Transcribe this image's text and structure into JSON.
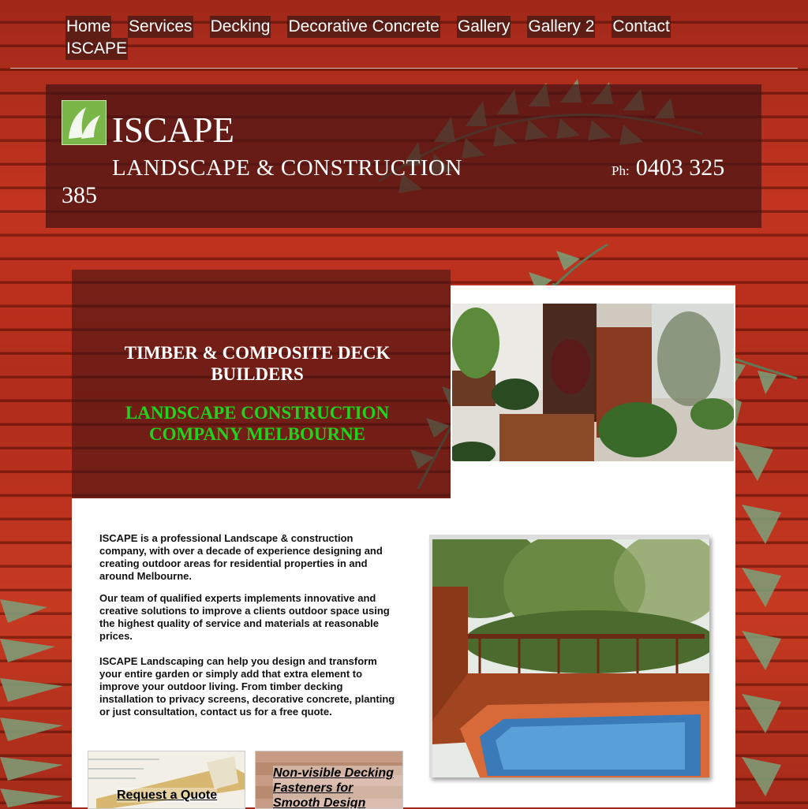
{
  "nav": {
    "items": [
      "Home",
      "Services",
      "Decking",
      "Decorative Concrete",
      "Gallery",
      "Gallery 2",
      "Contact",
      "ISCAPE"
    ]
  },
  "header": {
    "brand": "ISCAPE",
    "tagline": "LANDSCAPE & CONSTRUCTION",
    "phone_prefix": "Ph:",
    "phone_line1": "0403 325",
    "phone_line2": "385"
  },
  "hero": {
    "headline": "TIMBER & COMPOSITE DECK BUILDERS",
    "subheadline": "LANDSCAPE CONSTRUCTION COMPANY MELBOURNE"
  },
  "content": {
    "paragraphs": [
      "ISCAPE is a professional Landscape & construction company, with over a decade of experience designing and creating outdoor areas for residential properties in and around Melbourne.",
      "Our team of qualified experts implements innovative and creative solutions to improve a clients outdoor space using the highest quality of service and materials at reasonable prices.",
      "ISCAPE Landscaping can help you design and transform your entire garden or simply add that extra element to improve your outdoor living. From timber decking installation to privacy screens, decorative concrete, planting or just consultation, contact us for a free quote."
    ],
    "cards": {
      "quote": "Request a Quote",
      "fasteners": "Non-visible Decking Fasteners for Smooth Design"
    }
  },
  "colors": {
    "accent_green": "#1ed41e",
    "logo_green": "#7ab648",
    "wood_red": "#b02c1b"
  }
}
